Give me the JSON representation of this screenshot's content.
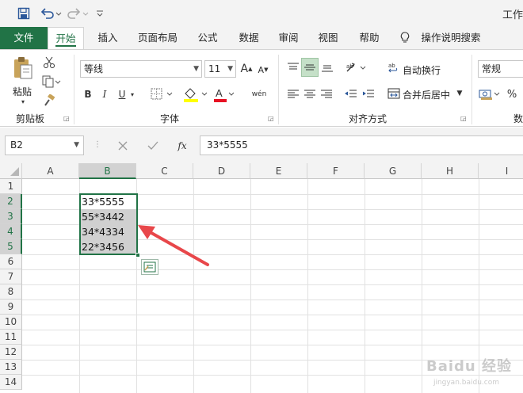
{
  "window": {
    "title_fragment": "工作"
  },
  "ribbon_tabs": [
    "文件",
    "开始",
    "插入",
    "页面布局",
    "公式",
    "数据",
    "审阅",
    "视图",
    "帮助",
    "操作说明搜索"
  ],
  "clipboard": {
    "paste_label": "粘贴",
    "group_label": "剪贴板"
  },
  "font": {
    "name": "等线",
    "size": "11",
    "group_label": "字体",
    "grow": "A",
    "shrink": "A",
    "bold": "B",
    "italic": "I",
    "underline": "U",
    "font_color_letter": "A",
    "phonetic": "wén"
  },
  "alignment": {
    "wrap_label": "自动换行",
    "merge_label": "合并后居中",
    "group_label": "对齐方式"
  },
  "number": {
    "format": "常规",
    "percent": "%",
    "group_label_fragment": "数"
  },
  "formula_bar": {
    "name_box": "B2",
    "formula": "33*5555",
    "fx": "fx"
  },
  "columns": [
    "A",
    "B",
    "C",
    "D",
    "E",
    "F",
    "G",
    "H",
    "I"
  ],
  "rows": [
    "1",
    "2",
    "3",
    "4",
    "5",
    "6",
    "7",
    "8",
    "9",
    "10",
    "11",
    "12",
    "13",
    "14"
  ],
  "cells": {
    "B2": "33*5555",
    "B3": "55*3442",
    "B4": "34*4334",
    "B5": "22*3456"
  },
  "annotation": {
    "arrow_color": "#e8474a"
  },
  "colors": {
    "accent": "#217346",
    "ribbon_bg": "#f3f3f3"
  },
  "watermark": {
    "text": "Baidu 经验",
    "sub": "jingyan.baidu.com"
  }
}
